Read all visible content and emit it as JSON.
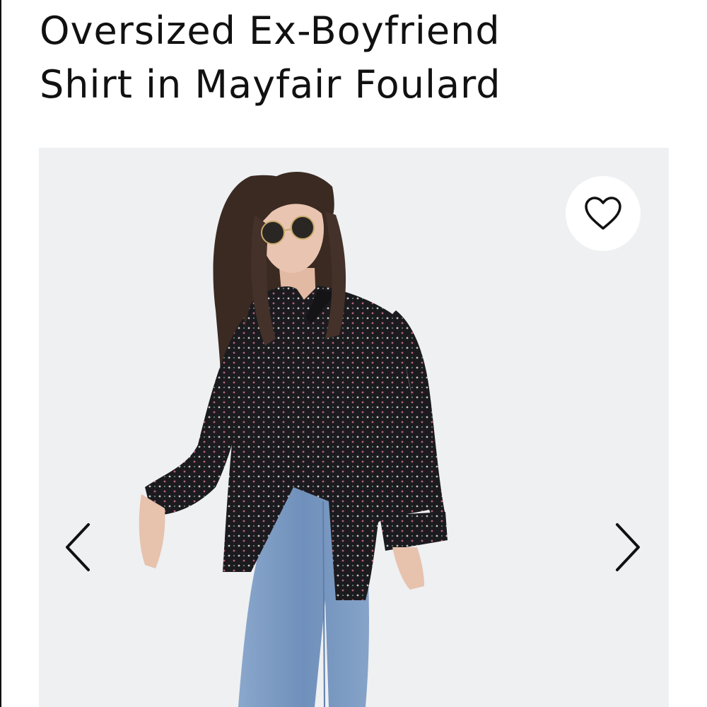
{
  "product": {
    "title_line1": "Oversized Ex-Boyfriend",
    "title_line2": "Shirt in Mayfair Foulard"
  },
  "gallery": {
    "background_color": "#eef0f2",
    "favorite_icon": "heart-outline-icon",
    "prev_icon": "chevron-left-icon",
    "next_icon": "chevron-right-icon"
  },
  "colors": {
    "shirt": "#1b1b1f",
    "denim": "#7d9cc4",
    "hair": "#3a2a22",
    "skin": "#e7c2ad"
  }
}
